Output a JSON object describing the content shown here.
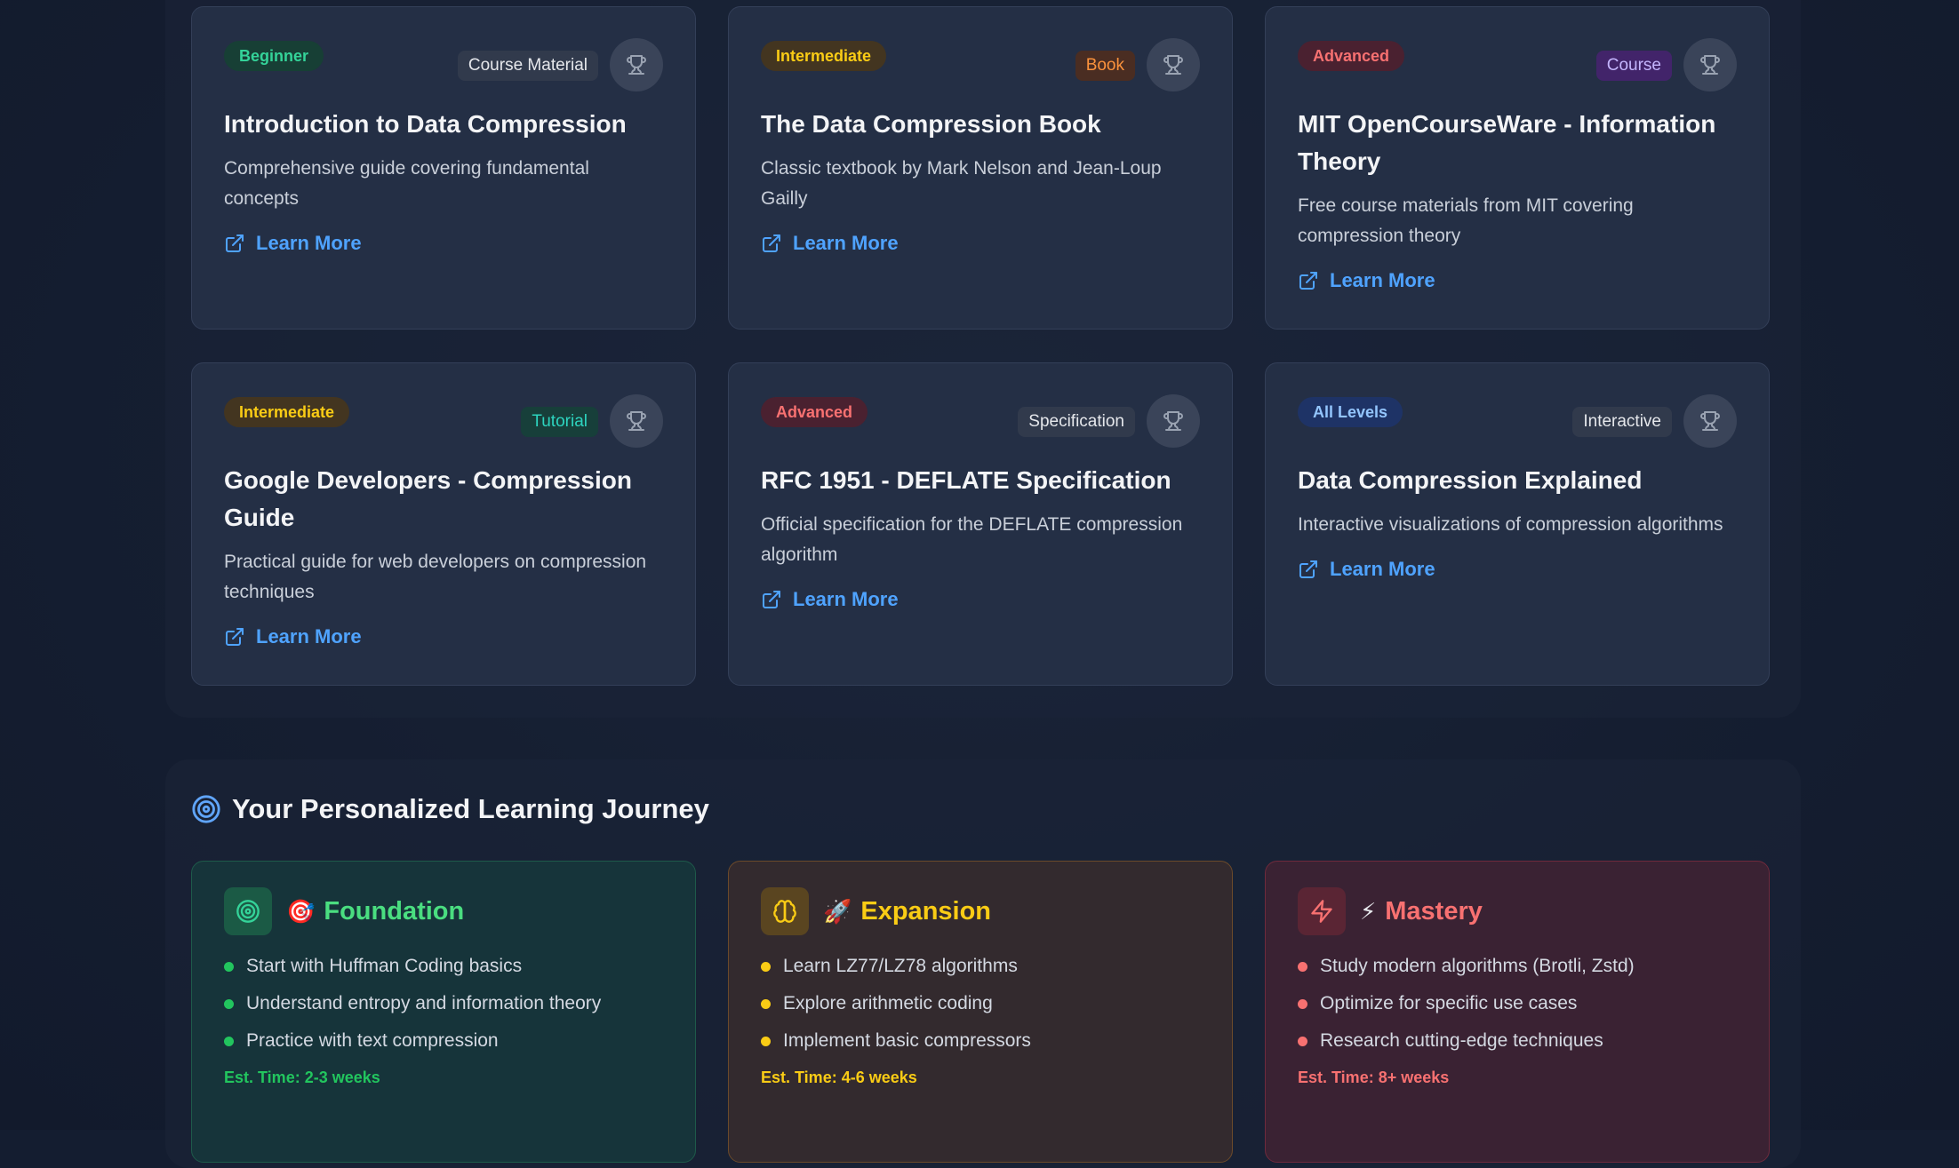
{
  "resources": [
    {
      "level": "Beginner",
      "type": "Course Material",
      "title": "Introduction to Data Compression",
      "description": "Comprehensive guide covering fundamental concepts",
      "link": "Learn More"
    },
    {
      "level": "Intermediate",
      "type": "Book",
      "title": "The Data Compression Book",
      "description": "Classic textbook by Mark Nelson and Jean-Loup Gailly",
      "link": "Learn More"
    },
    {
      "level": "Advanced",
      "type": "Course",
      "title": "MIT OpenCourseWare - Information Theory",
      "description": "Free course materials from MIT covering compression theory",
      "link": "Learn More"
    },
    {
      "level": "Intermediate",
      "type": "Tutorial",
      "title": "Google Developers - Compression Guide",
      "description": "Practical guide for web developers on compression techniques",
      "link": "Learn More"
    },
    {
      "level": "Advanced",
      "type": "Specification",
      "title": "RFC 1951 - DEFLATE Specification",
      "description": "Official specification for the DEFLATE compression algorithm",
      "link": "Learn More"
    },
    {
      "level": "All Levels",
      "type": "Interactive",
      "title": "Data Compression Explained",
      "description": "Interactive visualizations of compression algorithms",
      "link": "Learn More"
    }
  ],
  "colors": {
    "beginner": "#22c55e",
    "intermediate": "#facc15",
    "advanced": "#f87171",
    "all_levels": "#93c5fd",
    "link": "#4fa3ff"
  },
  "journey": {
    "heading": "Your Personalized Learning Journey",
    "stages": [
      {
        "emoji": "🎯",
        "title": "Foundation",
        "icon": "target-icon",
        "items": [
          "Start with Huffman Coding basics",
          "Understand entropy and information theory",
          "Practice with text compression"
        ],
        "est": "Est. Time: 2-3 weeks"
      },
      {
        "emoji": "🚀",
        "title": "Expansion",
        "icon": "brain-icon",
        "items": [
          "Learn LZ77/LZ78 algorithms",
          "Explore arithmetic coding",
          "Implement basic compressors"
        ],
        "est": "Est. Time: 4-6 weeks"
      },
      {
        "emoji": "⚡",
        "title": "Mastery",
        "icon": "lightning-icon",
        "items": [
          "Study modern algorithms (Brotli, Zstd)",
          "Optimize for specific use cases",
          "Research cutting-edge techniques"
        ],
        "est": "Est. Time: 8+ weeks"
      }
    ]
  }
}
